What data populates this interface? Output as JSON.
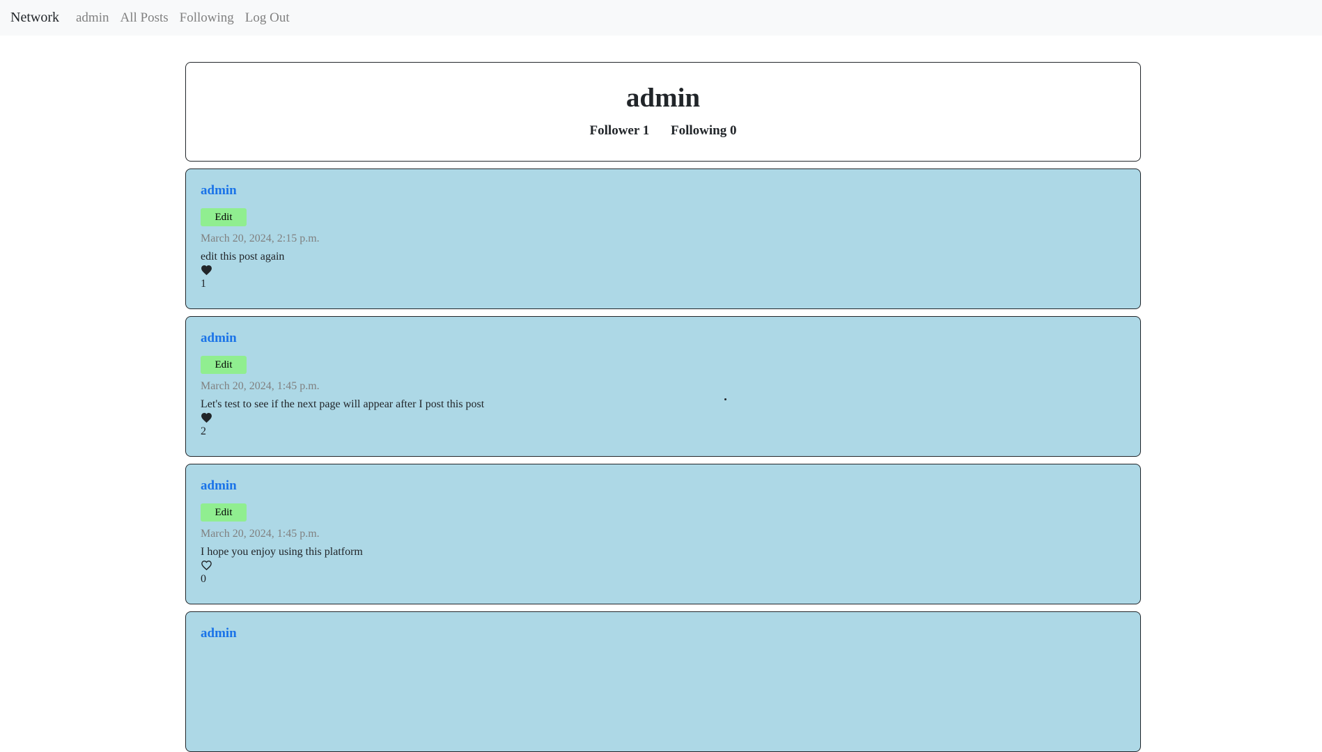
{
  "nav": {
    "brand": "Network",
    "links": [
      "admin",
      "All Posts",
      "Following",
      "Log Out"
    ]
  },
  "profile": {
    "username": "admin",
    "followers_label": "Follower 1",
    "following_label": "Following 0"
  },
  "posts": [
    {
      "author": "admin",
      "edit_label": "Edit",
      "timestamp": "March 20, 2024, 2:15 p.m.",
      "content": "edit this post again",
      "liked": true,
      "likes": "1"
    },
    {
      "author": "admin",
      "edit_label": "Edit",
      "timestamp": "March 20, 2024, 1:45 p.m.",
      "content": "Let's test to see if the next page will appear after I post this post",
      "liked": true,
      "likes": "2"
    },
    {
      "author": "admin",
      "edit_label": "Edit",
      "timestamp": "March 20, 2024, 1:45 p.m.",
      "content": "I hope you enjoy using this platform",
      "liked": false,
      "likes": "0"
    },
    {
      "author": "admin"
    }
  ],
  "colors": {
    "post_bg": "#add8e6",
    "edit_button": "#90ee90",
    "author_link": "#1a73e8",
    "navbar_bg": "#f8f9fa"
  },
  "icons": {
    "liked": "heart-filled-icon",
    "not_liked": "heart-outline-icon"
  }
}
